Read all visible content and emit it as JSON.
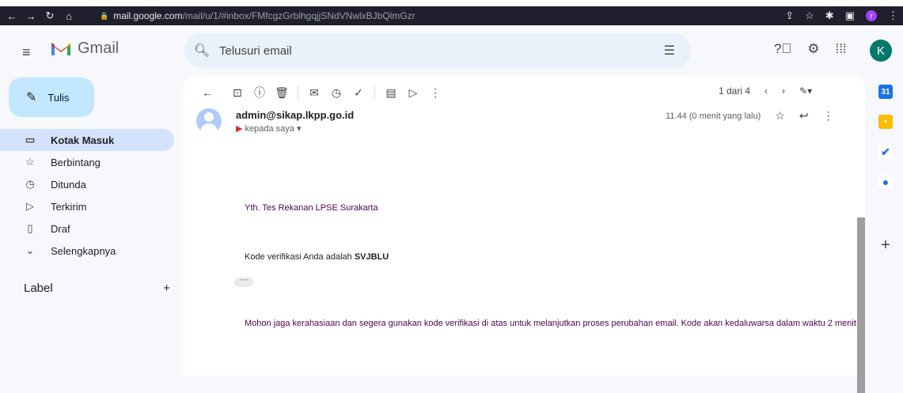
{
  "browser": {
    "url_host": "mail.google.com",
    "url_path": "/mail/u/1/#inbox/FMfcgzGrblhgqjjSNdVNwlxBJbQlmGzr",
    "profile_initial": "r"
  },
  "header": {
    "app_name": "Gmail",
    "search_placeholder": "Telusuri email",
    "account_initial": "K"
  },
  "sidebar": {
    "compose_label": "Tulis",
    "items": [
      {
        "label": "Kotak Masuk",
        "icon": "inbox-icon"
      },
      {
        "label": "Berbintang",
        "icon": "star-icon"
      },
      {
        "label": "Ditunda",
        "icon": "clock-icon"
      },
      {
        "label": "Terkirim",
        "icon": "send-icon"
      },
      {
        "label": "Draf",
        "icon": "file-icon"
      },
      {
        "label": "Selengkapnya",
        "icon": "chevron-down-icon"
      }
    ],
    "labels_heading": "Label"
  },
  "message": {
    "pager": "1 dari 4",
    "sender": "admin@sikap.lkpp.go.id",
    "to": "kepada saya",
    "time": "11.44 (0 menit yang lalu)",
    "greeting": "Yth. Tes Rekanan LPSE Surakarta",
    "code_prefix": "Kode verifikasi Anda adalah",
    "code": "SVJBLU",
    "notice": "Mohon jaga kerahasiaan dan segera gunakan kode verifikasi di atas untuk melanjutkan proses perubahan email. Kode akan kedaluwarsa dalam waktu 2 menit."
  },
  "colors": {
    "compose_bg": "#c2e7ff",
    "active_item_bg": "#d3e3fd",
    "search_bg": "#eaf1fb"
  }
}
